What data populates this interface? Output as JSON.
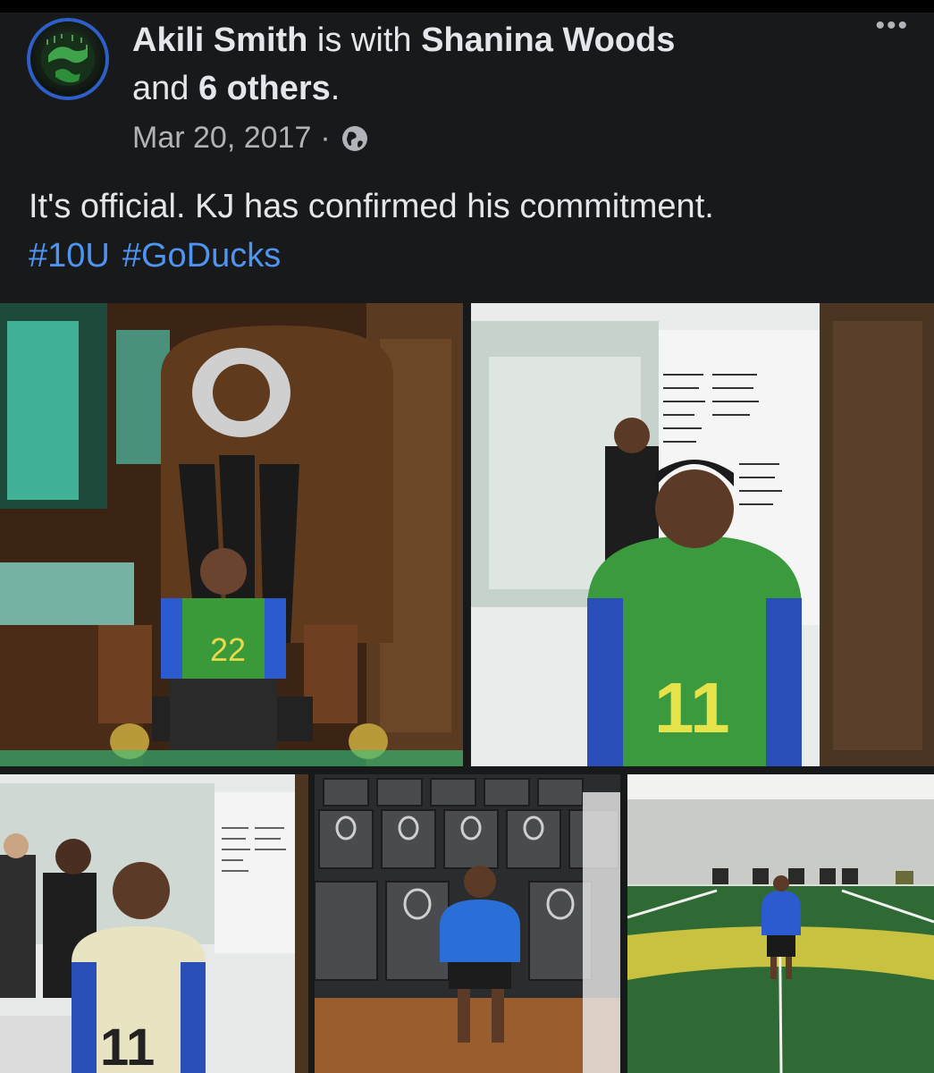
{
  "post": {
    "author": "Akili Smith",
    "with_text": " is with ",
    "tagged_person": "Shanina Woods",
    "and_text": "and ",
    "others": "6 others",
    "period": ".",
    "date": "Mar 20, 2017",
    "separator": "·",
    "privacy_icon": "globe-icon",
    "body": "It's official. KJ has confirmed his commitment.",
    "hashtags": [
      "#10U",
      "#GoDucks"
    ],
    "more_label": "•••"
  },
  "colors": {
    "background": "#18191b",
    "text": "#e4e6eb",
    "secondary": "#b0b3b8",
    "link": "#4e94f0",
    "avatar_ring": "#2f5ec9"
  },
  "photos": [
    {
      "id": "photo-throne"
    },
    {
      "id": "photo-whiteboard"
    },
    {
      "id": "photo-locker"
    },
    {
      "id": "photo-seats"
    },
    {
      "id": "photo-field"
    }
  ]
}
